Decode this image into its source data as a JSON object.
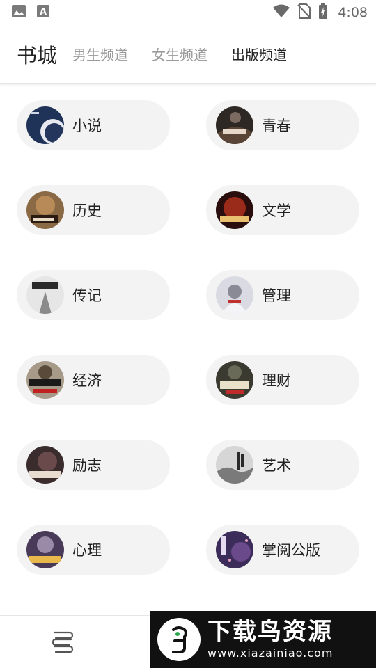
{
  "status_bar": {
    "time": "4:08",
    "left_icons": [
      "image-icon",
      "text-a-icon"
    ],
    "right_icons": [
      "wifi-icon",
      "no-sim-icon",
      "battery-charging-icon"
    ]
  },
  "header": {
    "title": "书城",
    "tabs": [
      {
        "label": "男生频道",
        "active": false
      },
      {
        "label": "女生频道",
        "active": false
      },
      {
        "label": "出版频道",
        "active": true
      }
    ]
  },
  "categories": [
    {
      "label": "小说",
      "cover_color": "#2a3f66"
    },
    {
      "label": "青春",
      "cover_color": "#3a2e2a"
    },
    {
      "label": "历史",
      "cover_color": "#6b4a2e"
    },
    {
      "label": "文学",
      "cover_color": "#5a1a1a"
    },
    {
      "label": "传记",
      "cover_color": "#d8d8d8"
    },
    {
      "label": "管理",
      "cover_color": "#c9c9d2"
    },
    {
      "label": "经济",
      "cover_color": "#7a6a55"
    },
    {
      "label": "理财",
      "cover_color": "#3c3c34"
    },
    {
      "label": "励志",
      "cover_color": "#4a3a3a"
    },
    {
      "label": "艺术",
      "cover_color": "#bdbdbd"
    },
    {
      "label": "心理",
      "cover_color": "#5a4a6a"
    },
    {
      "label": "掌阅公版",
      "cover_color": "#4a3a6a"
    }
  ],
  "bottom_nav": {
    "icons": [
      "bookshelf-icon"
    ]
  },
  "watermark": {
    "title": "下载鸟资源",
    "url": "www.xiazainiao.com"
  },
  "colors": {
    "pill_bg": "#f3f3f3",
    "active_tab": "#222222",
    "inactive_tab": "#9a9a9a"
  }
}
